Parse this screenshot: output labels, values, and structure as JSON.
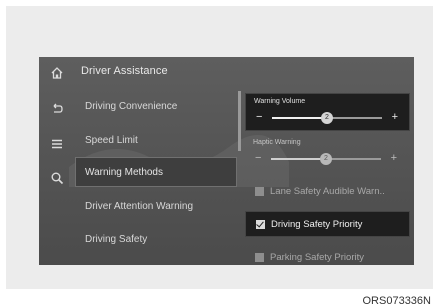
{
  "header": {
    "title": "Driver Assistance"
  },
  "sidebar_icons": [
    "home-icon",
    "back-icon",
    "menu-icon",
    "search-icon"
  ],
  "menu": {
    "items": [
      {
        "label": "Driving Convenience",
        "selected": false
      },
      {
        "label": "Speed Limit",
        "selected": false
      },
      {
        "label": "Warning Methods",
        "selected": true
      },
      {
        "label": "Driver Attention Warning",
        "selected": false
      },
      {
        "label": "Driving Safety",
        "selected": false
      }
    ]
  },
  "panel": {
    "warning_volume": {
      "label": "Warning Volume",
      "value": "2",
      "minus": "−",
      "plus": "+",
      "level": 0.5
    },
    "haptic_warning": {
      "label": "Haptic Warning",
      "value": "2",
      "minus": "−",
      "plus": "+",
      "level": 0.5
    },
    "options": [
      {
        "label": "Lane Safety Audible Warn..",
        "checked": false,
        "selected": false
      },
      {
        "label": "Driving Safety Priority",
        "checked": true,
        "selected": true
      },
      {
        "label": "Parking Safety Priority",
        "checked": false,
        "selected": false
      }
    ]
  },
  "caption": "ORS073336N",
  "colors": {
    "screen_bg": "#555555",
    "highlight_bg": "#1e1e1e",
    "text": "#e0e0e0"
  }
}
